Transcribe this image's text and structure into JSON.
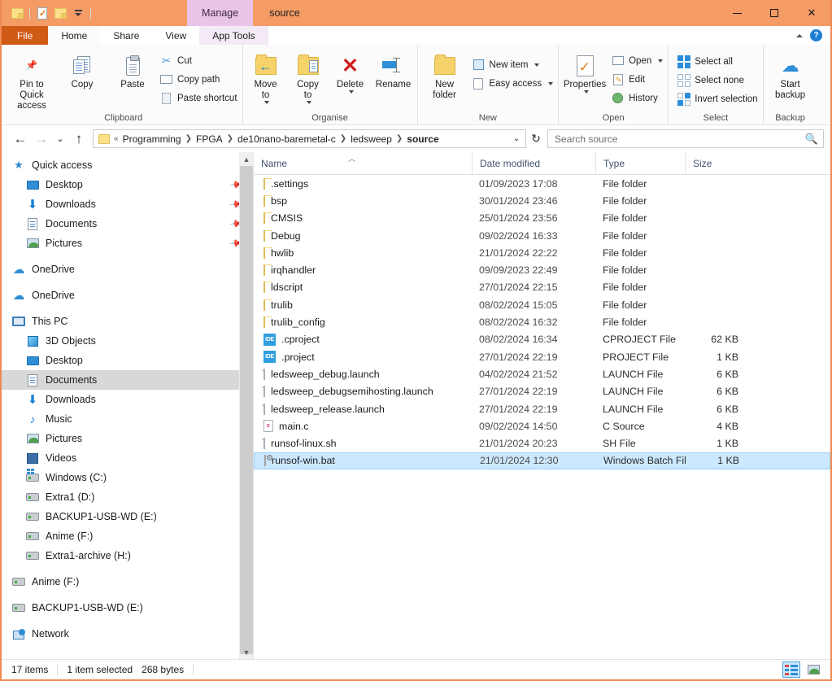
{
  "window": {
    "title": "source",
    "contextual_tab": "Manage",
    "quick_access": [
      {
        "name": "folder-icon",
        "label": "New folder"
      },
      {
        "name": "properties-icon",
        "label": "Properties"
      },
      {
        "name": "folder-icon",
        "label": "Folder"
      },
      {
        "name": "customize-dropdown-icon",
        "label": "Customize Quick Access Toolbar"
      }
    ],
    "controls": {
      "minimize": "Minimize",
      "maximize": "Maximize",
      "close": "Close"
    }
  },
  "ribbon": {
    "tabs": [
      {
        "label": "File",
        "kind": "file"
      },
      {
        "label": "Home",
        "kind": "active"
      },
      {
        "label": "Share",
        "kind": "normal"
      },
      {
        "label": "View",
        "kind": "normal"
      },
      {
        "label": "App Tools",
        "kind": "contextual"
      }
    ],
    "collapse_label": "Minimise the Ribbon",
    "help_label": "?",
    "groups": [
      {
        "label": "Clipboard",
        "big": [
          {
            "label": "Pin to Quick\naccess",
            "icon": "pin-icon"
          },
          {
            "label": "Copy",
            "icon": "copy-icon"
          },
          {
            "label": "Paste",
            "icon": "paste-icon"
          }
        ],
        "small": [
          {
            "label": "Cut",
            "icon": "scissors-icon"
          },
          {
            "label": "Copy path",
            "icon": "copy-path-icon"
          },
          {
            "label": "Paste shortcut",
            "icon": "paste-shortcut-icon"
          }
        ]
      },
      {
        "label": "Organise",
        "big": [
          {
            "label": "Move\nto",
            "icon": "move-to-icon",
            "dropdown": true
          },
          {
            "label": "Copy\nto",
            "icon": "copy-to-icon",
            "dropdown": true
          },
          {
            "label": "Delete",
            "icon": "delete-icon",
            "dropdown": true
          },
          {
            "label": "Rename",
            "icon": "rename-icon"
          }
        ],
        "small": []
      },
      {
        "label": "New",
        "big": [
          {
            "label": "New\nfolder",
            "icon": "new-folder-icon"
          }
        ],
        "small": [
          {
            "label": "New item",
            "icon": "new-item-icon",
            "dropdown": true
          },
          {
            "label": "Easy access",
            "icon": "easy-access-icon",
            "dropdown": true
          }
        ]
      },
      {
        "label": "Open",
        "big": [
          {
            "label": "Properties",
            "icon": "properties-icon",
            "dropdown": true
          }
        ],
        "small": [
          {
            "label": "Open",
            "icon": "open-icon",
            "dropdown": true
          },
          {
            "label": "Edit",
            "icon": "edit-icon"
          },
          {
            "label": "History",
            "icon": "history-icon"
          }
        ]
      },
      {
        "label": "Select",
        "big": [],
        "small": [
          {
            "label": "Select all",
            "icon": "select-all-icon"
          },
          {
            "label": "Select none",
            "icon": "select-none-icon"
          },
          {
            "label": "Invert selection",
            "icon": "invert-selection-icon"
          }
        ]
      },
      {
        "label": "Backup",
        "big": [
          {
            "label": "Start\nbackup",
            "icon": "cloud-upload-icon"
          }
        ],
        "small": []
      }
    ]
  },
  "navbar": {
    "back": "Back",
    "forward": "Forward",
    "recent": "Recent locations",
    "up": "Up one level",
    "breadcrumbs": [
      "Programming",
      "FPGA",
      "de10nano-baremetal-c",
      "ledsweep",
      "source"
    ],
    "breadcrumb_prefix": "«",
    "refresh": "Refresh",
    "search_placeholder": "Search source"
  },
  "sidebar": {
    "items": [
      {
        "label": "Quick access",
        "icon": "star-icon",
        "indent": 0,
        "pinned": false,
        "selected": false,
        "gap_before": false
      },
      {
        "label": "Desktop",
        "icon": "monitor-icon",
        "indent": 1,
        "pinned": true,
        "selected": false,
        "gap_before": false
      },
      {
        "label": "Downloads",
        "icon": "download-icon",
        "indent": 1,
        "pinned": true,
        "selected": false,
        "gap_before": false
      },
      {
        "label": "Documents",
        "icon": "document-icon",
        "indent": 1,
        "pinned": true,
        "selected": false,
        "gap_before": false
      },
      {
        "label": "Pictures",
        "icon": "picture-icon",
        "indent": 1,
        "pinned": true,
        "selected": false,
        "gap_before": false
      },
      {
        "label": "OneDrive",
        "icon": "cloud-icon",
        "indent": 0,
        "pinned": false,
        "selected": false,
        "gap_before": true
      },
      {
        "label": "OneDrive",
        "icon": "cloud-icon",
        "indent": 0,
        "pinned": false,
        "selected": false,
        "gap_before": true
      },
      {
        "label": "This PC",
        "icon": "pc-icon",
        "indent": 0,
        "pinned": false,
        "selected": false,
        "gap_before": true
      },
      {
        "label": "3D Objects",
        "icon": "3d-objects-icon",
        "indent": 1,
        "pinned": false,
        "selected": false,
        "gap_before": false
      },
      {
        "label": "Desktop",
        "icon": "monitor-icon",
        "indent": 1,
        "pinned": false,
        "selected": false,
        "gap_before": false
      },
      {
        "label": "Documents",
        "icon": "document-icon",
        "indent": 1,
        "pinned": false,
        "selected": true,
        "gap_before": false
      },
      {
        "label": "Downloads",
        "icon": "download-icon",
        "indent": 1,
        "pinned": false,
        "selected": false,
        "gap_before": false
      },
      {
        "label": "Music",
        "icon": "music-icon",
        "indent": 1,
        "pinned": false,
        "selected": false,
        "gap_before": false
      },
      {
        "label": "Pictures",
        "icon": "picture-icon",
        "indent": 1,
        "pinned": false,
        "selected": false,
        "gap_before": false
      },
      {
        "label": "Videos",
        "icon": "video-icon",
        "indent": 1,
        "pinned": false,
        "selected": false,
        "gap_before": false
      },
      {
        "label": "Windows (C:)",
        "icon": "windows-drive-icon",
        "indent": 1,
        "pinned": false,
        "selected": false,
        "gap_before": false
      },
      {
        "label": "Extra1 (D:)",
        "icon": "drive-icon",
        "indent": 1,
        "pinned": false,
        "selected": false,
        "gap_before": false
      },
      {
        "label": "BACKUP1-USB-WD (E:)",
        "icon": "drive-icon",
        "indent": 1,
        "pinned": false,
        "selected": false,
        "gap_before": false
      },
      {
        "label": "Anime (F:)",
        "icon": "drive-icon",
        "indent": 1,
        "pinned": false,
        "selected": false,
        "gap_before": false
      },
      {
        "label": "Extra1-archive (H:)",
        "icon": "drive-icon",
        "indent": 1,
        "pinned": false,
        "selected": false,
        "gap_before": false
      },
      {
        "label": "Anime (F:)",
        "icon": "drive-icon",
        "indent": 0,
        "pinned": false,
        "selected": false,
        "gap_before": true
      },
      {
        "label": "BACKUP1-USB-WD (E:)",
        "icon": "drive-icon",
        "indent": 0,
        "pinned": false,
        "selected": false,
        "gap_before": true
      },
      {
        "label": "Network",
        "icon": "network-icon",
        "indent": 0,
        "pinned": false,
        "selected": false,
        "gap_before": true
      }
    ]
  },
  "filelist": {
    "columns": [
      {
        "key": "name",
        "label": "Name",
        "sorted": "asc"
      },
      {
        "key": "date",
        "label": "Date modified",
        "sorted": ""
      },
      {
        "key": "type",
        "label": "Type",
        "sorted": ""
      },
      {
        "key": "size",
        "label": "Size",
        "sorted": ""
      }
    ],
    "rows": [
      {
        "name": ".settings",
        "date": "01/09/2023 17:08",
        "type": "File folder",
        "size": "",
        "icon": "folder-icon",
        "selected": false
      },
      {
        "name": "bsp",
        "date": "30/01/2024 23:46",
        "type": "File folder",
        "size": "",
        "icon": "folder-icon",
        "selected": false
      },
      {
        "name": "CMSIS",
        "date": "25/01/2024 23:56",
        "type": "File folder",
        "size": "",
        "icon": "folder-icon",
        "selected": false
      },
      {
        "name": "Debug",
        "date": "09/02/2024 16:33",
        "type": "File folder",
        "size": "",
        "icon": "folder-icon",
        "selected": false
      },
      {
        "name": "hwlib",
        "date": "21/01/2024 22:22",
        "type": "File folder",
        "size": "",
        "icon": "folder-icon",
        "selected": false
      },
      {
        "name": "irqhandler",
        "date": "09/09/2023 22:49",
        "type": "File folder",
        "size": "",
        "icon": "folder-icon",
        "selected": false
      },
      {
        "name": "ldscript",
        "date": "27/01/2024 22:15",
        "type": "File folder",
        "size": "",
        "icon": "folder-icon",
        "selected": false
      },
      {
        "name": "trulib",
        "date": "08/02/2024 15:05",
        "type": "File folder",
        "size": "",
        "icon": "folder-icon",
        "selected": false
      },
      {
        "name": "trulib_config",
        "date": "08/02/2024 16:32",
        "type": "File folder",
        "size": "",
        "icon": "folder-icon",
        "selected": false
      },
      {
        "name": ".cproject",
        "date": "08/02/2024 16:34",
        "type": "CPROJECT File",
        "size": "62 KB",
        "icon": "ide-file-icon",
        "selected": false
      },
      {
        "name": ".project",
        "date": "27/01/2024 22:19",
        "type": "PROJECT File",
        "size": "1 KB",
        "icon": "ide-file-icon",
        "selected": false
      },
      {
        "name": "ledsweep_debug.launch",
        "date": "04/02/2024 21:52",
        "type": "LAUNCH File",
        "size": "6 KB",
        "icon": "generic-file-icon",
        "selected": false
      },
      {
        "name": "ledsweep_debugsemihosting.launch",
        "date": "27/01/2024 22:19",
        "type": "LAUNCH File",
        "size": "6 KB",
        "icon": "generic-file-icon",
        "selected": false
      },
      {
        "name": "ledsweep_release.launch",
        "date": "27/01/2024 22:19",
        "type": "LAUNCH File",
        "size": "6 KB",
        "icon": "generic-file-icon",
        "selected": false
      },
      {
        "name": "main.c",
        "date": "09/02/2024 14:50",
        "type": "C Source",
        "size": "4 KB",
        "icon": "c-source-icon",
        "selected": false
      },
      {
        "name": "runsof-linux.sh",
        "date": "21/01/2024 20:23",
        "type": "SH File",
        "size": "1 KB",
        "icon": "generic-file-icon",
        "selected": false
      },
      {
        "name": "runsof-win.bat",
        "date": "21/01/2024 12:30",
        "type": "Windows Batch File",
        "size": "1 KB",
        "icon": "batch-file-icon",
        "selected": true
      }
    ]
  },
  "statusbar": {
    "item_count": "17 items",
    "selection": "1 item selected",
    "selection_size": "268 bytes",
    "view_details": "Details view",
    "view_thumbnails": "Large icons view"
  },
  "colors": {
    "titlebar": "#f59b66",
    "file_tab": "#cf5a16",
    "contextual_tab": "#e9c4e9",
    "selection": "#cce8ff",
    "selection_border": "#99d1ff",
    "sidebar_selection": "#d8d8d8",
    "accent_blue": "#2f8ed6"
  }
}
